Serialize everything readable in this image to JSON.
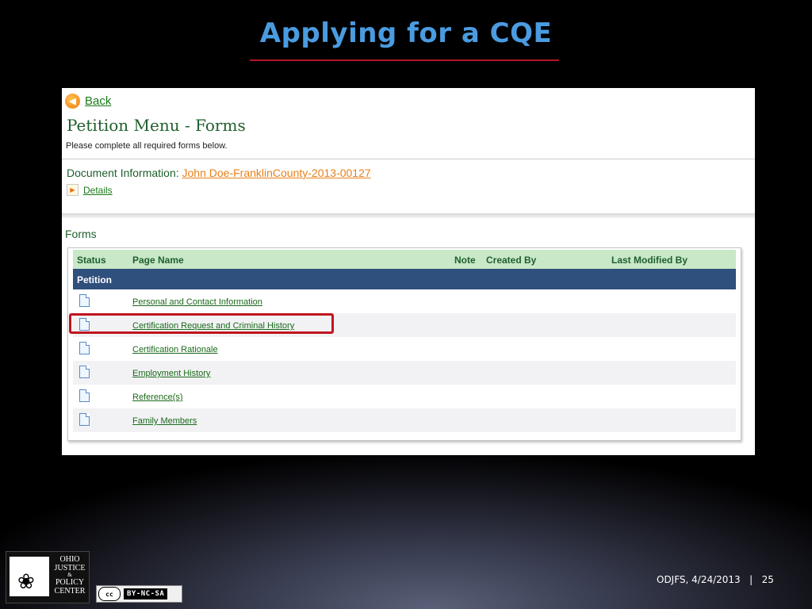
{
  "slide": {
    "title": "Applying for a CQE",
    "footer": "ODJFS, 4/24/2013   |   25"
  },
  "screen": {
    "back_label": "Back",
    "page_title": "Petition Menu - Forms",
    "subtitle": "Please complete all required forms below.",
    "doc_info_label": "Document Information: ",
    "doc_info_link": "John Doe-FranklinCounty-2013-00127",
    "details_label": "Details",
    "forms_label": "Forms",
    "table": {
      "headers": {
        "status": "Status",
        "page_name": "Page Name",
        "note": "Note",
        "created_by": "Created By",
        "last_modified_by": "Last Modified By"
      },
      "group_label": "Petition",
      "rows": [
        {
          "page_name": "Personal and Contact Information",
          "icon": "document-icon"
        },
        {
          "page_name": "Certification Request and Criminal History",
          "icon": "document-icon",
          "highlighted": true
        },
        {
          "page_name": "Certification Rationale",
          "icon": "document-icon"
        },
        {
          "page_name": "Employment History",
          "icon": "document-icon"
        },
        {
          "page_name": "Reference(s)",
          "icon": "document-icon"
        },
        {
          "page_name": "Family Members",
          "icon": "document-icon"
        }
      ]
    }
  },
  "logo": {
    "lines": [
      "OHIO",
      "JUSTICE",
      "&",
      "POLICY",
      "CENTER"
    ]
  },
  "license": {
    "cc": "cc",
    "text": "BY-NC-SA"
  },
  "colors": {
    "title": "#4a9be0",
    "rule": "#b4142a",
    "header_bg": "#c8e8c8",
    "group_bg": "#2f4f7c",
    "highlight": "#c0141e",
    "link_orange": "#e8801a"
  }
}
